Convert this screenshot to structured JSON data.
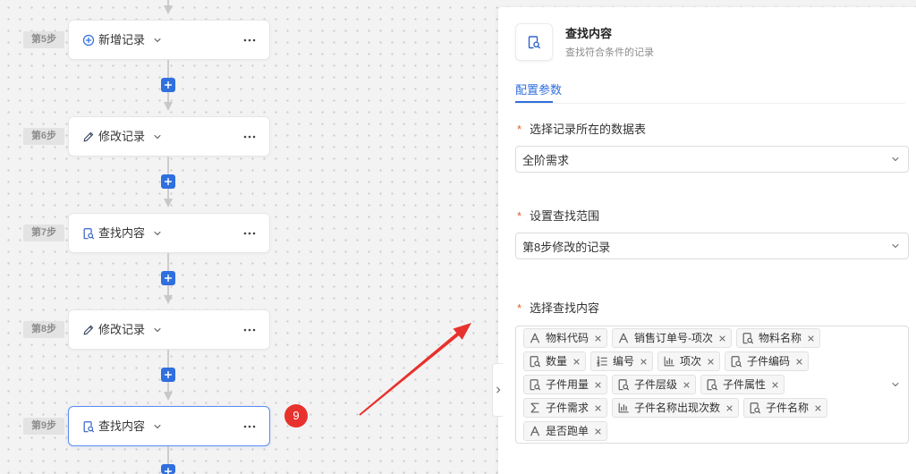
{
  "canvas": {
    "steps": [
      {
        "label": "第5步",
        "title": "新增记录",
        "icon": "add-circle-icon",
        "selected": false
      },
      {
        "label": "第6步",
        "title": "修改记录",
        "icon": "pencil-icon",
        "selected": false
      },
      {
        "label": "第7步",
        "title": "查找内容",
        "icon": "lookup-icon",
        "selected": false
      },
      {
        "label": "第8步",
        "title": "修改记录",
        "icon": "pencil-icon",
        "selected": false
      },
      {
        "label": "第9步",
        "title": "查找内容",
        "icon": "lookup-icon",
        "selected": true
      }
    ],
    "step_caret_icon": "chevron-down-icon",
    "step_menu_icon": "more-dots-icon",
    "add_step_icon": "plus-icon"
  },
  "annotation": {
    "badge": "9"
  },
  "panel": {
    "header": {
      "icon": "lookup-icon",
      "title": "查找内容",
      "subtitle": "查找符合条件的记录"
    },
    "tabs": [
      {
        "label": "配置参数",
        "active": true
      }
    ],
    "fields": [
      {
        "required_mark": "*",
        "label": "选择记录所在的数据表",
        "value": "全阶需求",
        "caret_icon": "chevron-down-icon"
      },
      {
        "required_mark": "*",
        "label": "设置查找范围",
        "value": "第8步修改的记录",
        "caret_icon": "chevron-down-icon"
      },
      {
        "required_mark": "*",
        "label": "选择查找内容",
        "caret_icon": "chevron-down-icon",
        "tag_remove_icon": "close-icon",
        "tags": [
          {
            "label": "物料代码",
            "icon": "text-icon"
          },
          {
            "label": "销售订单号-项次",
            "icon": "text-icon"
          },
          {
            "label": "物料名称",
            "icon": "lookup-icon"
          },
          {
            "label": "数量",
            "icon": "lookup-icon"
          },
          {
            "label": "编号",
            "icon": "auto-number-icon"
          },
          {
            "label": "项次",
            "icon": "count-icon"
          },
          {
            "label": "子件编码",
            "icon": "lookup-icon"
          },
          {
            "label": "子件用量",
            "icon": "lookup-icon"
          },
          {
            "label": "子件层级",
            "icon": "lookup-icon"
          },
          {
            "label": "子件属性",
            "icon": "lookup-icon"
          },
          {
            "label": "子件需求",
            "icon": "sum-icon"
          },
          {
            "label": "子件名称出现次数",
            "icon": "count-icon"
          },
          {
            "label": "子件名称",
            "icon": "lookup-icon"
          },
          {
            "label": "是否跑单",
            "icon": "text-icon"
          }
        ]
      }
    ],
    "collapse_icon": "chevron-right-icon"
  },
  "colors": {
    "accent": "#2f6fde",
    "selected_border": "#5b8def",
    "annotation_red": "#e8322d",
    "required_mark": "#e5602d",
    "canvas_background": "#f3f3f3"
  }
}
